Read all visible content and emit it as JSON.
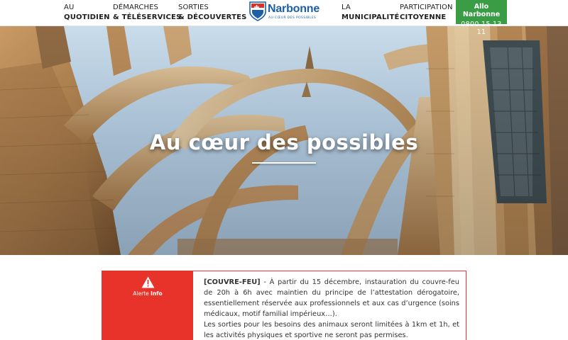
{
  "nav": {
    "quotidien": {
      "line1": "AU",
      "line2": "QUOTIDIEN"
    },
    "demarches": {
      "line1": "DÉMARCHES",
      "line2": "& TÉLÉSERVICES"
    },
    "sorties": {
      "line1": "SORTIES",
      "line2": "& DÉCOUVERTES"
    },
    "municipalite": {
      "line1": "LA",
      "line2": "MUNICIPALITÉ"
    },
    "participation": {
      "line1": "PARTICIPATION",
      "line2": "CITOYENNE"
    }
  },
  "logo": {
    "name": "Narbonne",
    "tagline": "AU CŒUR DES POSSIBLES"
  },
  "allo": {
    "title": "Allo Narbonne",
    "phone": "0800 15 13 11"
  },
  "hero": {
    "title": "Au cœur des possibles"
  },
  "alert": {
    "label_prefix": "Alerte",
    "label_bold": "Info",
    "tag": "[COUVRE-FEU]",
    "text1": " - À partir du 15 décembre, instauration du couvre-feu de 20h à 6h avec maintien du principe de l’attestation dérogatoire, essentiellement réservée aux professionnels et aux cas d’urgence (soins médicaux, motif familial impérieux…).",
    "text2": "Les sorties pour les besoins des animaux seront limitées à 1km et 1h, et les activités physiques et sportive ne seront pas permises."
  },
  "colors": {
    "brand_blue": "#1d5fa6",
    "allo_green": "#3a9d46",
    "alert_red": "#e7332a"
  }
}
